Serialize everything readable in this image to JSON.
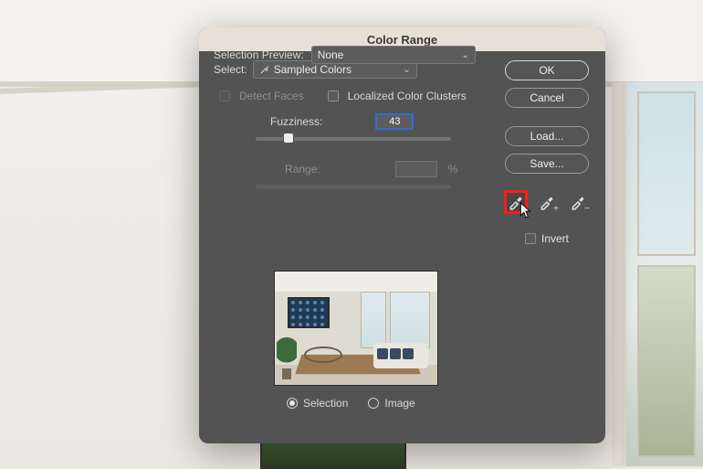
{
  "dialog": {
    "title": "Color Range",
    "select_label": "Select:",
    "select_value": "Sampled Colors",
    "detect_faces_label": "Detect Faces",
    "localized_clusters_label": "Localized Color Clusters",
    "fuzziness_label": "Fuzziness:",
    "fuzziness_value": "43",
    "range_label": "Range:",
    "range_value": "",
    "range_unit": "%",
    "radio_selection": "Selection",
    "radio_image": "Image",
    "selection_preview_label": "Selection Preview:",
    "selection_preview_value": "None"
  },
  "buttons": {
    "ok": "OK",
    "cancel": "Cancel",
    "load": "Load...",
    "save": "Save..."
  },
  "right": {
    "invert_label": "Invert"
  },
  "icons": {
    "eyedropper": "eyedropper-icon",
    "eyedropper_add": "eyedropper-add-icon",
    "eyedropper_sub": "eyedropper-subtract-icon"
  }
}
